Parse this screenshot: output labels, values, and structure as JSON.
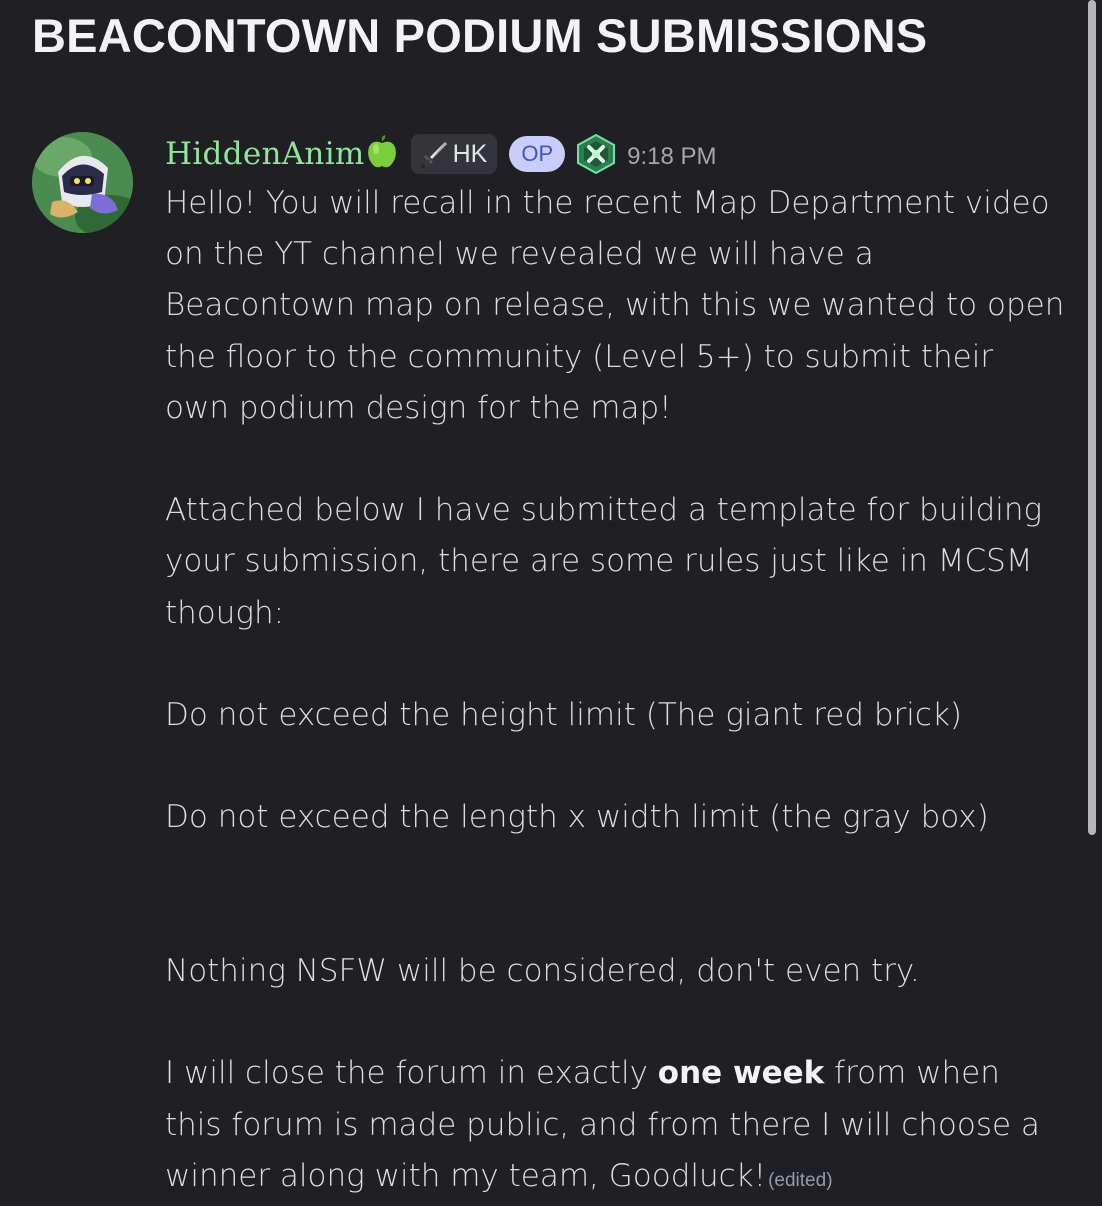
{
  "thread": {
    "title": "BEACONTOWN PODIUM SUBMISSIONS"
  },
  "message": {
    "author": "HiddenAnim",
    "author_emoji": "apple-icon",
    "role_tag": "HK",
    "role_icon": "sword-icon",
    "op_badge": "OP",
    "server_icon": "server-badge-icon",
    "timestamp": "9:18 PM",
    "paragraphs": {
      "p1": "Hello! You will recall in the recent Map Department video on the YT channel we revealed we will have a Beacontown map on release, with this we wanted to open the floor to the community (Level 5+) to submit their own podium design for the map!",
      "p2": "Attached below I have submitted a template for building your submission, there are some rules just like in MCSM though:",
      "p3": "Do not exceed the height limit (The giant red brick)",
      "p4": "Do not exceed the length x width limit (the gray box)",
      "p5": "Nothing NSFW will be considered, don't even try.",
      "p6_pre": "I will close the forum in exactly ",
      "p6_bold": "one week",
      "p6_post": " from when this forum is made public, and from there I will choose a winner along with my team, Goodluck!"
    },
    "edited_label": "(edited)"
  },
  "colors": {
    "background": "#1f1f24",
    "username": "#8ee59c",
    "op_badge_bg": "#c9cdfb",
    "op_badge_text": "#4752c4",
    "text": "#dbdee1"
  }
}
